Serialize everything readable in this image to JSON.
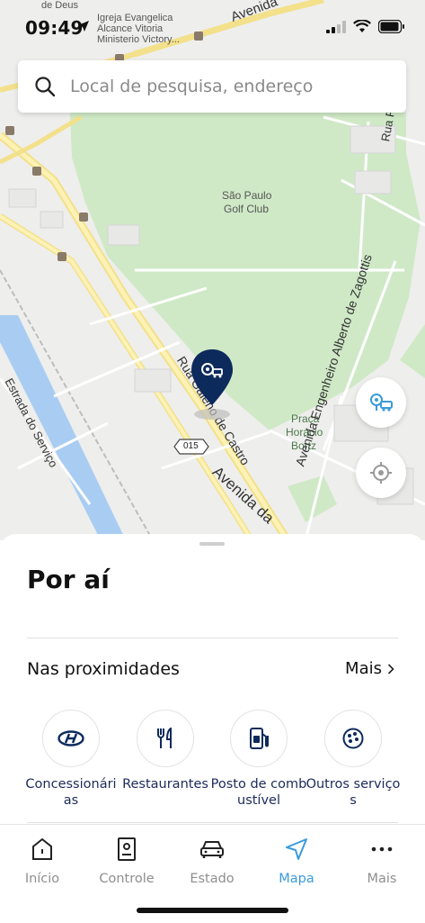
{
  "status_bar": {
    "time": "09:49"
  },
  "search": {
    "placeholder": "Local de pesquisa, endereço"
  },
  "map": {
    "labels": {
      "de_deus": "de Deus",
      "igreja_1": "Igreja Evangelica",
      "igreja_2": "Alcance Vitoria",
      "igreja_3": "Ministerio Victory...",
      "avenida_top": "Avenida",
      "golf_1": "São Paulo",
      "golf_2": "Golf Club",
      "rua_galeno": "Rua Galeno de Castro",
      "avenida_bottom": "Avenida da",
      "estrada": "Estrada do Serviço",
      "route": "015",
      "praca_1": "Praça",
      "praca_2": "Horácio",
      "praca_3": "Bortz",
      "av_engenheiro": "Avenida Engenheiro Alberto de Zagottis",
      "rua_right": "Rua F"
    }
  },
  "sheet": {
    "title": "Por aí",
    "section_title": "Nas proximidades",
    "more_label": "Mais",
    "categories": [
      {
        "label": "Concessionárias",
        "icon": "hyundai-logo-icon"
      },
      {
        "label": "Restaurantes",
        "icon": "fork-knife-icon"
      },
      {
        "label": "Posto de combustível",
        "icon": "fuel-pump-icon"
      },
      {
        "label": "Outros serviços",
        "icon": "other-services-icon"
      }
    ]
  },
  "tabs": [
    {
      "label": "Início",
      "icon": "home-icon",
      "active": false
    },
    {
      "label": "Controle",
      "icon": "remote-icon",
      "active": false
    },
    {
      "label": "Estado",
      "icon": "car-icon",
      "active": false
    },
    {
      "label": "Mapa",
      "icon": "navigation-arrow-icon",
      "active": true
    },
    {
      "label": "Mais",
      "icon": "more-dots-icon",
      "active": false
    }
  ],
  "colors": {
    "accent": "#3a9bd9",
    "brand_navy": "#0d2a5c",
    "park": "#c8e6c0",
    "water": "#a9cdf2"
  }
}
